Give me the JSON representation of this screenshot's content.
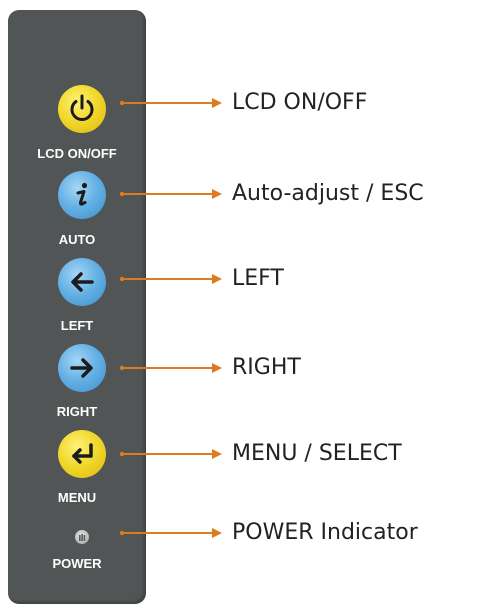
{
  "panel": {
    "buttons": [
      {
        "label": "LCD ON/OFF",
        "icon": "power-icon",
        "color": "#f2d92e"
      },
      {
        "label": "AUTO",
        "icon": "info-icon",
        "color": "#66b2e6"
      },
      {
        "label": "LEFT",
        "icon": "arrow-left-icon",
        "color": "#66b2e6"
      },
      {
        "label": "RIGHT",
        "icon": "arrow-right-icon",
        "color": "#66b2e6"
      },
      {
        "label": "MENU",
        "icon": "enter-icon",
        "color": "#f2d92e"
      }
    ],
    "indicator": {
      "label": "POWER",
      "icon": "power-led-icon"
    },
    "background_color": "#525555"
  },
  "callouts": [
    "LCD ON/OFF",
    "Auto-adjust / ESC",
    "LEFT",
    "RIGHT",
    "MENU / SELECT",
    "POWER Indicator"
  ],
  "arrow_color": "#e07a1f"
}
